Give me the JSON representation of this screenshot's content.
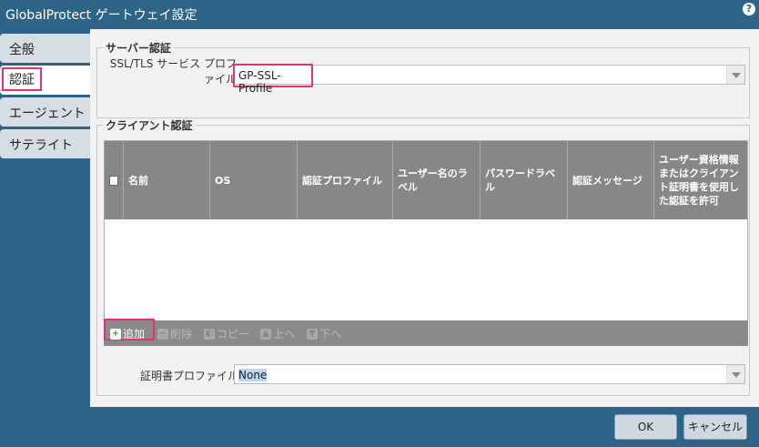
{
  "window": {
    "title": "GlobalProtect ゲートウェイ設定",
    "help": "?"
  },
  "sidebar": {
    "tabs": [
      {
        "label": "全般"
      },
      {
        "label": "認証"
      },
      {
        "label": "エージェント"
      },
      {
        "label": "サテライト"
      }
    ]
  },
  "server_auth": {
    "legend": "サーバー認証",
    "ssl_label": "SSL/TLS サービス プロファイル",
    "ssl_value": "GP-SSL-Profile"
  },
  "client_auth": {
    "legend": "クライアント認証",
    "columns": [
      "名前",
      "OS",
      "認証プロファイル",
      "ユーザー名のラベル",
      "パスワードラベル",
      "認証メッセージ",
      "ユーザー資格情報またはクライアント証明書を使用した認証を許可"
    ],
    "toolbar": {
      "add": "追加",
      "delete": "削除",
      "copy": "コピー",
      "up": "上へ",
      "down": "下へ"
    },
    "cert_label": "証明書プロファイル",
    "cert_value": "None"
  },
  "footer": {
    "ok": "OK",
    "cancel": "キャンセル"
  }
}
